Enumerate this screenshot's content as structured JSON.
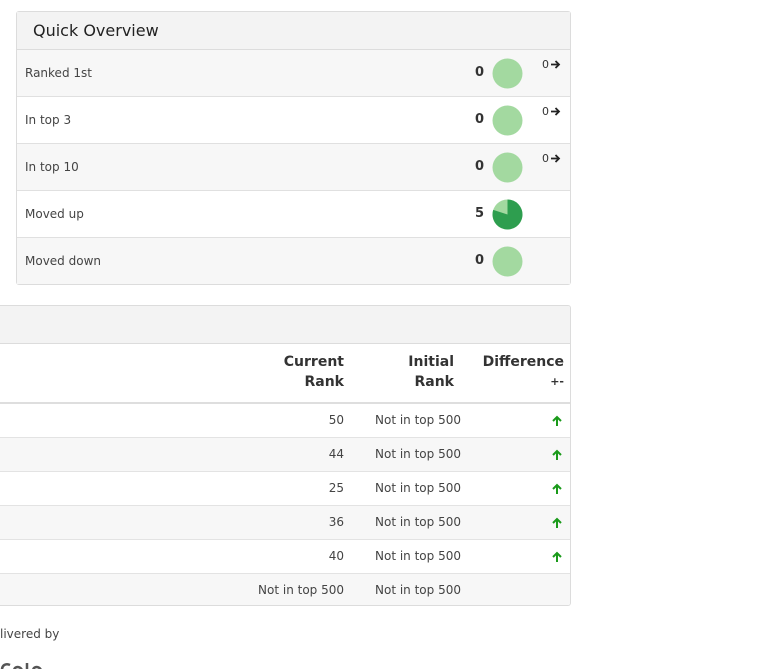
{
  "overview": {
    "title": "Quick Overview",
    "rows": [
      {
        "label": "Ranked 1st",
        "count": "0",
        "fraction": 0,
        "change": "0"
      },
      {
        "label": "In top 3",
        "count": "0",
        "fraction": 0,
        "change": "0"
      },
      {
        "label": "In top 10",
        "count": "0",
        "fraction": 0,
        "change": "0"
      },
      {
        "label": "Moved up",
        "count": "5",
        "fraction": 0.8,
        "change": ""
      },
      {
        "label": "Moved down",
        "count": "0",
        "fraction": 0,
        "change": ""
      }
    ],
    "colors": {
      "pie_light": "#a3d9a0",
      "pie_dark": "#2e9e4f"
    }
  },
  "table": {
    "headers": {
      "current_line1": "Current",
      "current_line2": "Rank",
      "initial_line1": "Initial",
      "initial_line2": "Rank",
      "diff_line1": "Difference",
      "diff_line2": "+-"
    },
    "rows": [
      {
        "current": "50",
        "initial": "Not in top 500",
        "diff": "up"
      },
      {
        "current": "44",
        "initial": "Not in top 500",
        "diff": "up"
      },
      {
        "current": "25",
        "initial": "Not in top 500",
        "diff": "up"
      },
      {
        "current": "36",
        "initial": "Not in top 500",
        "diff": "up"
      },
      {
        "current": "40",
        "initial": "Not in top 500",
        "diff": "up"
      },
      {
        "current": "Not in top 500",
        "initial": "Not in top 500",
        "diff": ""
      }
    ],
    "colors": {
      "arrow_up": "#1a9a1a"
    }
  },
  "footer": {
    "delivered_text": "livered by"
  }
}
